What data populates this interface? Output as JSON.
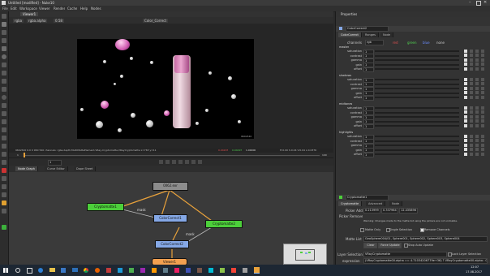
{
  "titlebar": {
    "title": "Untitled [modified] - Nuke10"
  },
  "menu": [
    "File",
    "Edit",
    "Workspace",
    "Viewer",
    "Render",
    "Cache",
    "Help",
    "Nodes"
  ],
  "viewer": {
    "tab": "Viewer1",
    "channels": "rgba",
    "channel_sel": "rgba.alpha",
    "gamma": "0.58",
    "cc_label": "Color_Correct",
    "format_label": "960x540",
    "status": "960x540  0.0 0 960 540 channels: rgba,depth,MultiMatteElement,VRay,Cryptomatte,VRayCryptomatte  x=763 y=11",
    "readout_values": [
      "0.04297",
      "0.04297",
      "1.00000"
    ],
    "readout_tail": "H:0.00 S:0.04 V:0.04  L:0.0376",
    "timeline_start": "1",
    "timeline_end": "100",
    "frame": "1"
  },
  "nodegraph": {
    "tabs": [
      "Node Graph",
      "Curve Editor",
      "Dope Sheet"
    ],
    "nodes": {
      "read": "0062.exr",
      "crypto1": "Cryptomatte1",
      "crypto2": "Cryptomatte2",
      "cc1": "ColorCorrect1",
      "cc2": "ColorCorrect2",
      "viewer": "Viewer1"
    },
    "mask_label": "mask",
    "mask_label_2": "mask"
  },
  "properties": {
    "title": "Properties",
    "node_name": "ColorCorrect2",
    "tabs": [
      "ColorCorrect",
      "Ranges",
      "Node"
    ],
    "channels_label": "channels",
    "channels_value": "rgb",
    "channel_toggles": [
      "red",
      "green",
      "blue",
      "none"
    ],
    "sections": [
      {
        "name": "master",
        "rows": [
          "saturation",
          "contrast",
          "gamma",
          "gain",
          "offset"
        ]
      },
      {
        "name": "shadows",
        "rows": [
          "saturation",
          "contrast",
          "gamma",
          "gain",
          "offset"
        ]
      },
      {
        "name": "midtones",
        "rows": [
          "saturation",
          "contrast",
          "gamma",
          "gain",
          "offset"
        ]
      },
      {
        "name": "highlights",
        "rows": [
          "saturation",
          "contrast",
          "gamma",
          "gain",
          "offset"
        ]
      }
    ],
    "default_value": "1",
    "crypto": {
      "node_name": "Cryptomatte1",
      "tabs": [
        "Cryptomatte",
        "Advanced",
        "Node"
      ],
      "picker_add_label": "Picker Add",
      "picker_add_values": [
        "0.213999",
        "0.337964",
        "12.435896"
      ],
      "picker_remove_label": "Picker Remove",
      "warning": "Warning: Changes made to the matte list using the pickers are not undoable.",
      "matte_only": "Matte Only",
      "single_selection": "Single Selection",
      "remove_channels": "Remove Channels",
      "matte_list_label": "Matte List",
      "matte_list_value": "GeoSphere004/01, Sphere001, Sphere002, Sphere003, Sphere004",
      "clear_btn": "Clear",
      "force_update_btn": "Force Update",
      "stop_update": "Stop Auto Update",
      "layer_sel_label": "Layer Selection",
      "layer_sel_value": "VRayCryptomatte",
      "lock_layer": "Lock Layer Selection",
      "expression_label": "expression",
      "expression_value": "(VRayCryptomatte00.alpha == 4.71034206779e+36) ? VRayCryptomatte00.alpha : 0.0) + 0"
    }
  },
  "taskbar": {
    "time": "12:07",
    "date": "17.08.2017"
  },
  "colors": {
    "node_read": "#8c8c8c",
    "node_crypto": "#4ccf3a",
    "node_cc": "#85a8e6",
    "node_viewer": "#f2a050",
    "arrow": "#e9a23b"
  }
}
